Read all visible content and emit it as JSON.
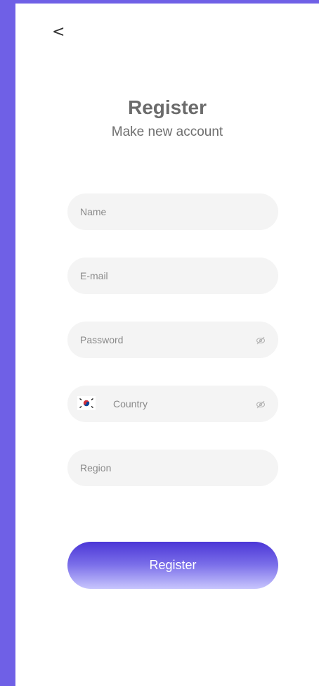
{
  "nav": {
    "back_label": "<"
  },
  "header": {
    "title": "Register",
    "subtitle": "Make new account"
  },
  "form": {
    "name_placeholder": "Name",
    "email_placeholder": "E-mail",
    "password_placeholder": "Password",
    "country_placeholder": "Country",
    "region_placeholder": "Region",
    "password_toggle_icon": "eye-off-icon",
    "country_toggle_icon": "eye-off-icon",
    "country_flag_icon": "south-korea-flag-icon",
    "submit_label": "Register"
  },
  "colors": {
    "background": "#6f60e6",
    "screen": "#ffffff",
    "field": "#f4f4f4",
    "button_top": "#4b36d6",
    "button_bottom": "#c8c6fd"
  }
}
